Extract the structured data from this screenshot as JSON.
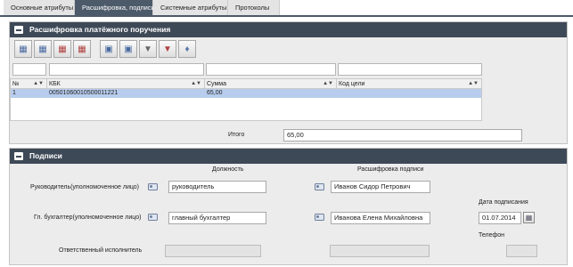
{
  "tabs": [
    {
      "label": "Основные атрибуты"
    },
    {
      "label": "Расшифровка, подписи"
    },
    {
      "label": "Системные атрибуты"
    },
    {
      "label": "Протоколы"
    }
  ],
  "payment_panel": {
    "title": "Расшифровка платёжного поручения",
    "toolbar_icons": [
      "add-row-icon",
      "add-copy-icon",
      "delete-row-icon",
      "edit-row-icon",
      "view-icon",
      "filter-icon",
      "clear-filter-icon",
      "print-icon"
    ],
    "grid": {
      "columns": [
        "№",
        "КБК",
        "Сумма",
        "Код цели"
      ],
      "rows": [
        {
          "num": "1",
          "kbk": "00501060010500011221",
          "sum": "65,00",
          "goal_code": ""
        }
      ]
    },
    "total_label": "Итого",
    "total_value": "65,00"
  },
  "signatures_panel": {
    "title": "Подписи",
    "position_header": "Должность",
    "decoding_header": "Расшифровка подписи",
    "head_label": "Руководитель(уполномоченное лицо)",
    "head_position": "руководитель",
    "head_name": "Иванов Сидор Петрович",
    "accountant_label": "Гл. бухгалтер(уполномоченное лицо)",
    "accountant_position": "главный бухгалтер",
    "accountant_name": "Иванова Елена Михайловна",
    "sign_date_label": "Дата подписания",
    "sign_date": "01.07.2014",
    "phone_label": "Телефон",
    "executor_label": "Ответственный исполнитель",
    "executor_value": "",
    "executor_name": "",
    "phone_value": ""
  }
}
